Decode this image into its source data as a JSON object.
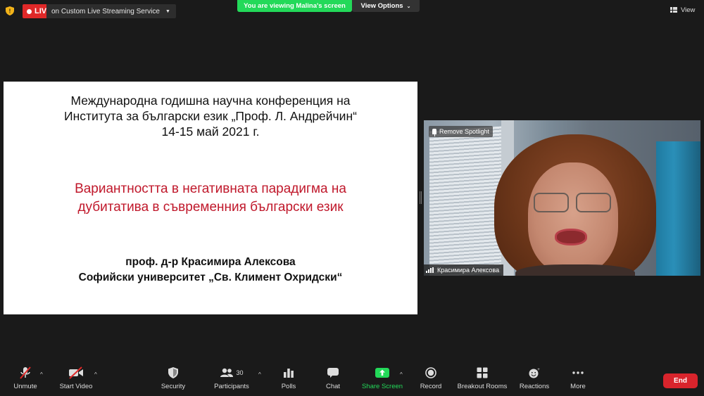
{
  "top_bar": {
    "live_label": "LIVE",
    "stream_service": "on Custom Live Streaming Service",
    "viewing_banner": "You are viewing Malina's screen",
    "view_options_label": "View Options",
    "view_label": "View"
  },
  "slide": {
    "conference_line1": "Международна годишна научна конференция на",
    "conference_line2": "Института за български език „Проф. Л. Андрейчин“",
    "conference_line3": "14-15 май 2021 г.",
    "topic_line1": "Вариантността в негативната парадигма на",
    "topic_line2": "дубитатива в съвременния български език",
    "author_line1": "проф. д-р Красимира Алексова",
    "author_line2": "Софийски университет „Св. Климент Охридски“"
  },
  "video": {
    "spotlight_label": "Remove Spotlight",
    "participant_name": "Красимира Алексова"
  },
  "toolbar": {
    "unmute": "Unmute",
    "start_video": "Start Video",
    "security": "Security",
    "participants": "Participants",
    "participants_count": "30",
    "polls": "Polls",
    "chat": "Chat",
    "share_screen": "Share Screen",
    "record": "Record",
    "breakout_rooms": "Breakout Rooms",
    "reactions": "Reactions",
    "more": "More",
    "end": "End"
  },
  "colors": {
    "live_red": "#e02828",
    "banner_green": "#23d959",
    "slide_topic_red": "#c0182b",
    "end_red": "#d8242c"
  }
}
